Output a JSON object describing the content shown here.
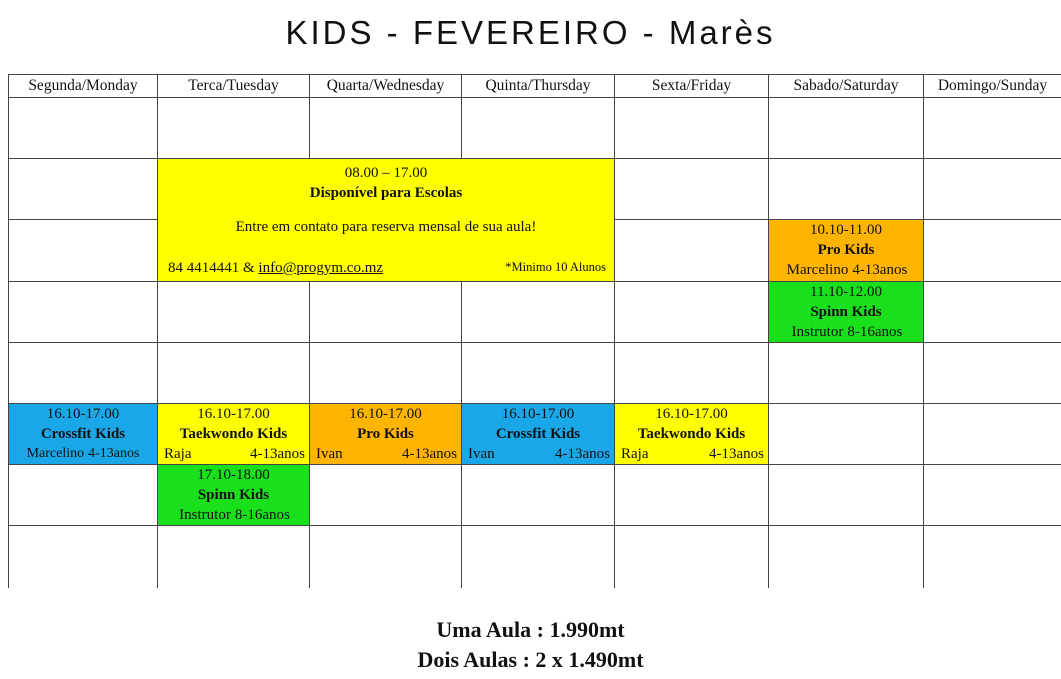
{
  "title": "KIDS - FEVEREIRO - Marès",
  "days": [
    "Segunda/Monday",
    "Terca/Tuesday",
    "Quarta/Wednesday",
    "Quinta/Thursday",
    "Sexta/Friday",
    "Sabado/Saturday",
    "Domingo/Sunday"
  ],
  "promo": {
    "time": "08.00 – 17.00",
    "title": "Disponível para Escolas",
    "text": "Entre em contato para reserva mensal de sua aula!",
    "phone": "84 4414441 &",
    "email": "info@progym.co.mz",
    "minimum": "*Minimo 10 Alunos"
  },
  "classes": {
    "sat_pro": {
      "time": "10.10-11.00",
      "name": "Pro Kids",
      "instructor": "Marcelino",
      "ages": "4-13anos"
    },
    "sat_spinn": {
      "time": "11.10-12.00",
      "name": "Spinn Kids",
      "instructor": "Instrutor",
      "ages": "8-16anos"
    },
    "mon_crossfit": {
      "time": "16.10-17.00",
      "name": "Crossfit Kids",
      "instructor": "Marcelino",
      "ages": "4-13anos"
    },
    "tue_taekwondo": {
      "time": "16.10-17.00",
      "name": "Taekwondo Kids",
      "instructor": "Raja",
      "ages": "4-13anos"
    },
    "wed_pro": {
      "time": "16.10-17.00",
      "name": "Pro Kids",
      "instructor": "Ivan",
      "ages": "4-13anos"
    },
    "thu_crossfit": {
      "time": "16.10-17.00",
      "name": "Crossfit Kids",
      "instructor": "Ivan",
      "ages": "4-13anos"
    },
    "fri_taekwondo": {
      "time": "16.10-17.00",
      "name": "Taekwondo Kids",
      "instructor": "Raja",
      "ages": "4-13anos"
    },
    "tue_spinn": {
      "time": "17.10-18.00",
      "name": "Spinn Kids",
      "instructor": "Instrutor",
      "ages": "8-16anos"
    }
  },
  "pricing": {
    "one_class": "Uma Aula : 1.990mt",
    "two_classes": "Dois Aulas : 2 x 1.490mt"
  }
}
